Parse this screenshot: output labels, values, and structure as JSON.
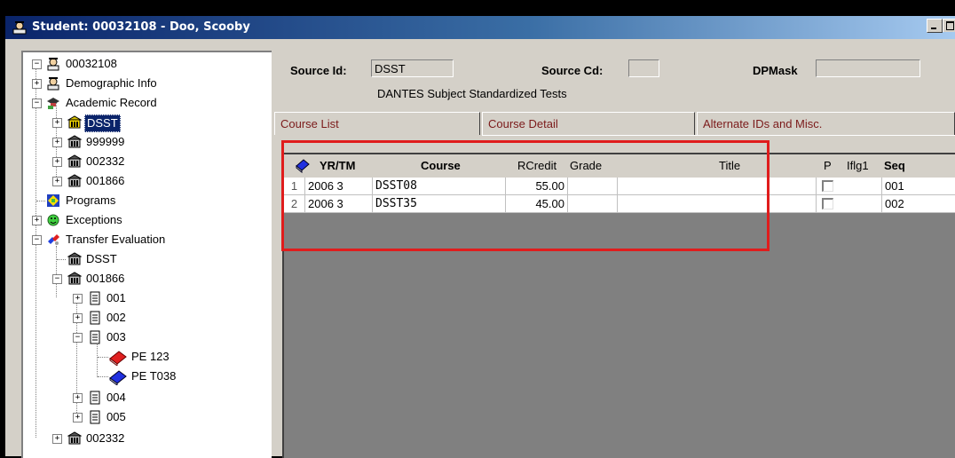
{
  "window": {
    "title": "Student: 00032108 - Doo, Scooby"
  },
  "tree": {
    "root": "00032108",
    "demographic": "Demographic Info",
    "academic": "Academic Record",
    "acad_items": [
      "DSST",
      "999999",
      "002332",
      "001866"
    ],
    "programs": "Programs",
    "exceptions": "Exceptions",
    "transfer": "Transfer Evaluation",
    "transfer_dsst": "DSST",
    "transfer_001866": "001866",
    "subs": [
      "001",
      "002",
      "003"
    ],
    "courses": [
      "PE  123",
      "PE  T038"
    ],
    "subs2": [
      "004",
      "005"
    ],
    "last": "002332"
  },
  "header": {
    "source_id_label": "Source Id:",
    "source_id_value": "DSST",
    "source_cd_label": "Source Cd:",
    "source_cd_value": "",
    "dpmask_label": "DPMask",
    "dpmask_value": "",
    "description": "DANTES Subject Standardized Tests"
  },
  "tabs": [
    "Course List",
    "Course Detail",
    "Alternate IDs and Misc."
  ],
  "grid": {
    "columns": {
      "yrtm": "YR/TM",
      "course": "Course",
      "rcredit": "RCredit",
      "grade": "Grade",
      "title": "Title",
      "p": "P",
      "iflg1": "Iflg1",
      "seq": "Seq"
    },
    "rows": [
      {
        "num": "1",
        "yrtm": "2006 3",
        "course": "DSST08",
        "rcredit": "55.00",
        "grade": "",
        "title": "",
        "seq": "001"
      },
      {
        "num": "2",
        "yrtm": "2006 3",
        "course": "DSST35",
        "rcredit": "45.00",
        "grade": "",
        "title": "",
        "seq": "002"
      }
    ]
  },
  "colors": {
    "titlebar": "#0a246a",
    "highlight": "#e01c1c",
    "tab_text": "#7b1a1a",
    "selected": "#0a246a"
  }
}
